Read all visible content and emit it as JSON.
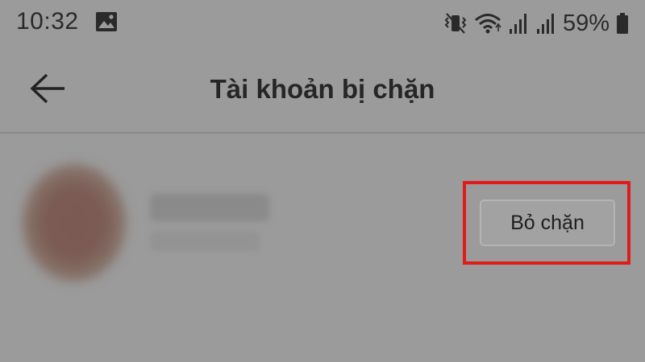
{
  "status_bar": {
    "time": "10:32",
    "battery_percent": "59%",
    "icons": [
      "gallery-icon",
      "vibrate-icon",
      "wifi-icon",
      "signal-icon",
      "signal-icon",
      "battery-icon"
    ]
  },
  "header": {
    "title": "Tài khoản bị chặn",
    "back_icon": "arrow-left-icon"
  },
  "blocked_account": {
    "unblock_label": "Bỏ chặn",
    "highlight_color": "#e01b1b"
  }
}
